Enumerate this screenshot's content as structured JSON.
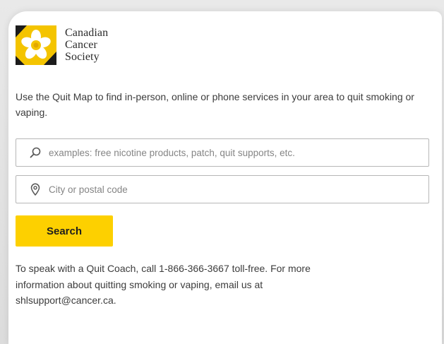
{
  "brand": {
    "logo_icon": "daffodil-logo-icon",
    "name_line1": "Canadian",
    "name_line2": "Cancer",
    "name_line3": "Society",
    "color": "#f4c400"
  },
  "intro_text": "Use the Quit Map to find in-person, online or phone services in your area to quit smoking or vaping.",
  "search": {
    "icon": "search-icon",
    "placeholder": "examples: free nicotine products, patch, quit supports, etc.",
    "value": ""
  },
  "location": {
    "icon": "location-pin-icon",
    "placeholder": "City or postal code",
    "value": ""
  },
  "search_button": {
    "label": "Search",
    "color": "#fdd000"
  },
  "contact": {
    "line1": "To speak with a Quit Coach, call 1-866-366-3667 toll-free. For more",
    "line2": "information about quitting smoking or vaping, email us at",
    "line3": "shlsupport@cancer.ca."
  }
}
